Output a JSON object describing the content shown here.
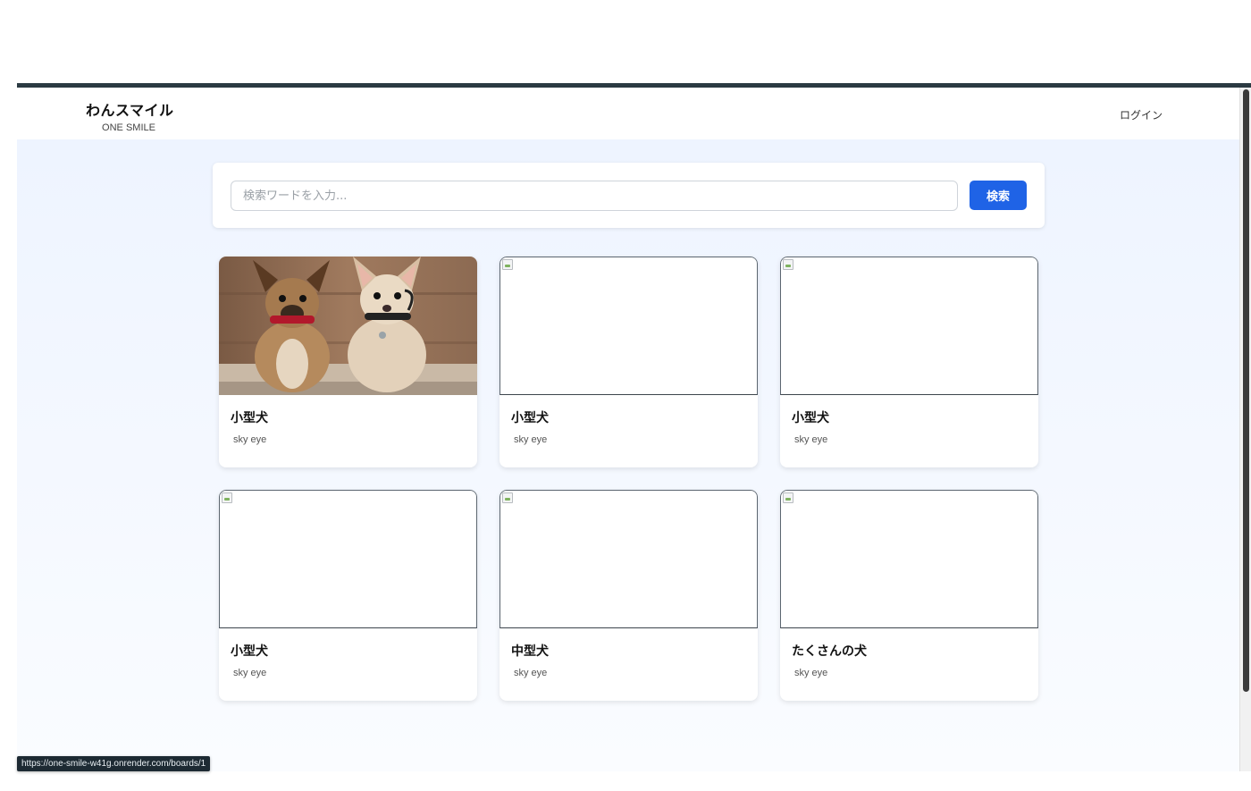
{
  "header": {
    "brand_title": "わんスマイル",
    "brand_subtitle": "ONE SMILE",
    "login_label": "ログイン"
  },
  "search": {
    "placeholder": "検索ワードを入力...",
    "button_label": "検索"
  },
  "cards": [
    {
      "title": "小型犬",
      "author": "sky eye",
      "image": "two-chihuahua-puppies-photo"
    },
    {
      "title": "小型犬",
      "author": "sky eye",
      "image": "broken-image"
    },
    {
      "title": "小型犬",
      "author": "sky eye",
      "image": "broken-image"
    },
    {
      "title": "小型犬",
      "author": "sky eye",
      "image": "broken-image"
    },
    {
      "title": "中型犬",
      "author": "sky eye",
      "image": "broken-image"
    },
    {
      "title": "たくさんの犬",
      "author": "sky eye",
      "image": "broken-image"
    }
  ],
  "status_bar": {
    "url": "https://one-smile-w41g.onrender.com/boards/1"
  },
  "colors": {
    "primary_button": "#1f63e6",
    "top_border": "#2b3a42",
    "page_background": "#eef4ff"
  }
}
